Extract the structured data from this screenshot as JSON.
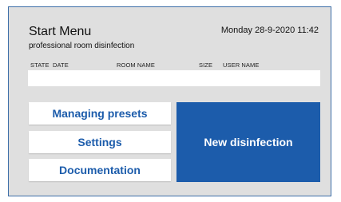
{
  "header": {
    "title": "Start Menu",
    "subtitle": "professional room disinfection",
    "datetime": "Monday 28-9-2020 11:42"
  },
  "table": {
    "columns": [
      "STATE",
      "DATE",
      "ROOM NAME",
      "SIZE",
      "USER NAME"
    ],
    "rows": []
  },
  "menu": {
    "managing_presets": "Managing presets",
    "settings": "Settings",
    "documentation": "Documentation",
    "new_disinfection": "New disinfection"
  },
  "colors": {
    "accent": "#1c5cab",
    "panel_bg": "#dfdfdf",
    "border": "#3d6ea8"
  }
}
